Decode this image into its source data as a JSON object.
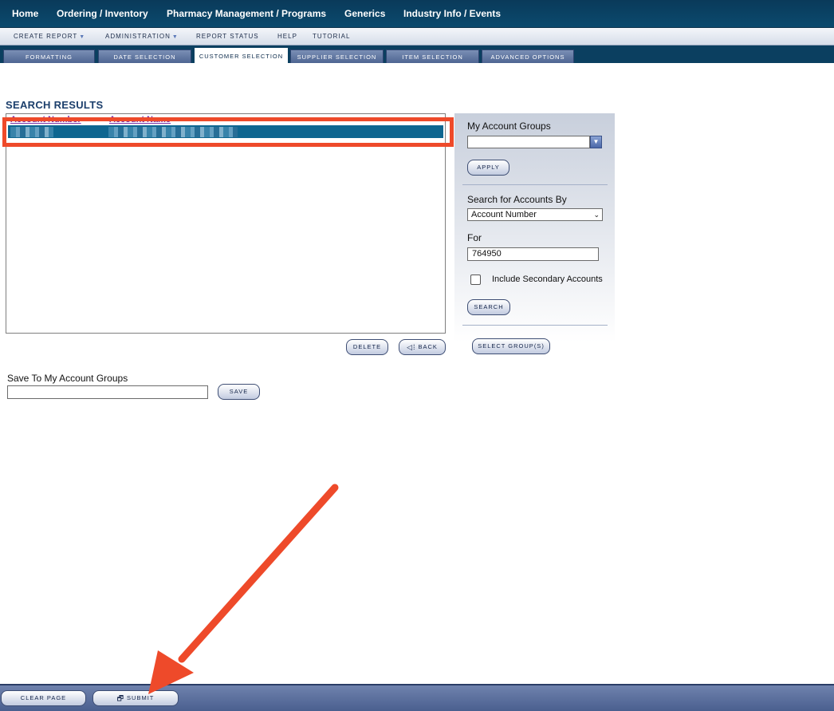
{
  "topnav": {
    "items": [
      "Home",
      "Ordering / Inventory",
      "Pharmacy Management / Programs",
      "Generics",
      "Industry Info / Events"
    ]
  },
  "subnav": {
    "items": [
      {
        "label": "Create Report",
        "dropdown": true
      },
      {
        "label": "Administration",
        "dropdown": true
      },
      {
        "label": "Report Status",
        "dropdown": false
      },
      {
        "label": "Help",
        "dropdown": false
      },
      {
        "label": "Tutorial",
        "dropdown": false
      }
    ]
  },
  "tabs": {
    "items": [
      "Formatting",
      "Date Selection",
      "Customer Selection",
      "Supplier Selection",
      "Item Selection",
      "Advanced Options"
    ],
    "active": "Customer Selection"
  },
  "results": {
    "title": "SEARCH RESULTS",
    "columns": [
      "Account Number",
      "Account Name"
    ],
    "delete_label": "Delete",
    "back_label": "Back",
    "back_icon": "back-arrow-icon"
  },
  "panel": {
    "groups_label": "My Account Groups",
    "apply_label": "Apply",
    "search_by_label": "Search for Accounts By",
    "search_by_value": "Account Number",
    "for_label": "For",
    "for_value": "764950",
    "secondary_label": "Include Secondary Accounts",
    "secondary_checked": false,
    "search_label": "Search",
    "select_groups_label": "Select Group(s)"
  },
  "save": {
    "label": "Save To My Account Groups",
    "value": "",
    "button_label": "Save"
  },
  "bottom": {
    "clear_label": "Clear Page",
    "submit_label": "Submit",
    "submit_icon": "report-edit-icon"
  },
  "annotations": {
    "highlight_color": "#ee4a2a",
    "arrow_color": "#ee4a2a"
  }
}
